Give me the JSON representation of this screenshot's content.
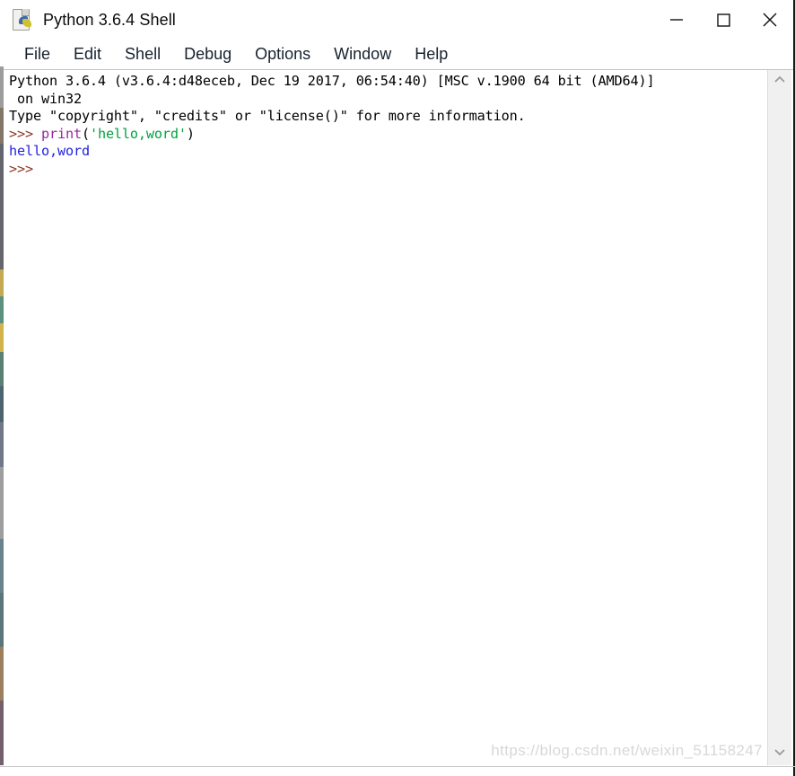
{
  "window": {
    "title": "Python 3.6.4 Shell",
    "icon": "python-idle-icon",
    "controls": {
      "minimize": "minimize-icon",
      "maximize": "maximize-icon",
      "close": "close-icon"
    }
  },
  "menubar": {
    "items": [
      {
        "label": "File"
      },
      {
        "label": "Edit"
      },
      {
        "label": "Shell"
      },
      {
        "label": "Debug"
      },
      {
        "label": "Options"
      },
      {
        "label": "Window"
      },
      {
        "label": "Help"
      }
    ]
  },
  "shell": {
    "lines": [
      {
        "segments": [
          {
            "text": "Python 3.6.4 (v3.6.4:d48eceb, Dec 19 2017, 06:54:40) [MSC v.1900 64 bit (AMD64)]",
            "type": "plain"
          }
        ]
      },
      {
        "segments": [
          {
            "text": " on win32",
            "type": "plain"
          }
        ]
      },
      {
        "segments": [
          {
            "text": "Type \"copyright\", \"credits\" or \"license()\" for more information.",
            "type": "plain"
          }
        ]
      },
      {
        "segments": [
          {
            "text": ">>> ",
            "type": "prompt"
          },
          {
            "text": "print",
            "type": "keyword"
          },
          {
            "text": "(",
            "type": "plain"
          },
          {
            "text": "'hello,word'",
            "type": "string"
          },
          {
            "text": ")",
            "type": "plain"
          }
        ]
      },
      {
        "segments": [
          {
            "text": "hello,word",
            "type": "output"
          }
        ]
      },
      {
        "segments": [
          {
            "text": ">>> ",
            "type": "prompt"
          }
        ]
      }
    ]
  },
  "scrollbar": {
    "up_arrow": "chevron-up-icon",
    "down_arrow": "chevron-down-icon"
  },
  "watermark": {
    "text": "https://blog.csdn.net/weixin_51158247"
  },
  "colors": {
    "prompt": "#8b3a29",
    "keyword": "#9a27a0",
    "string": "#00a33f",
    "output": "#2222dd",
    "plain": "#000000",
    "background": "#ffffff",
    "menu_text": "#16212e"
  }
}
